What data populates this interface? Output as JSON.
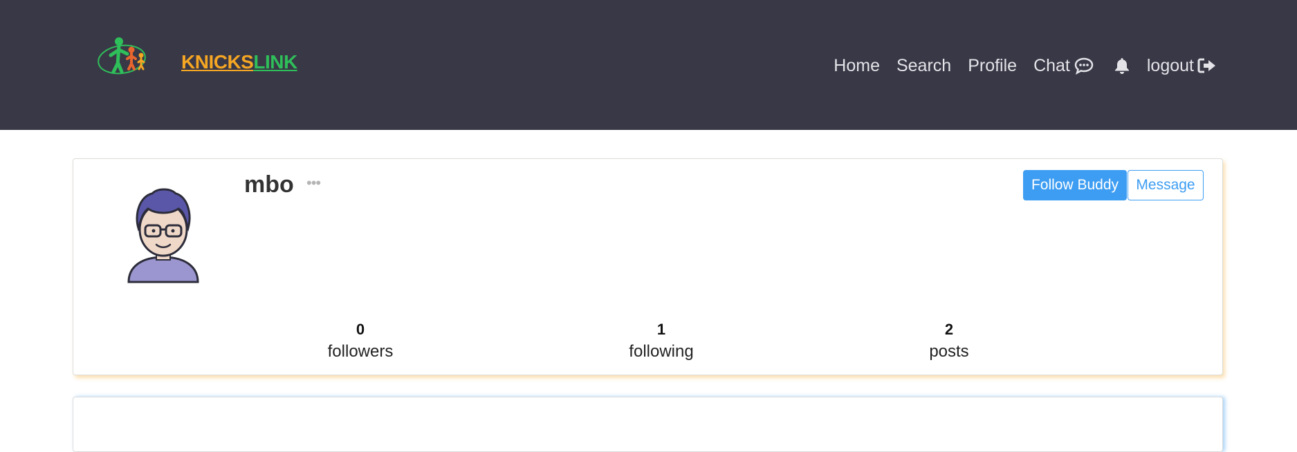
{
  "header": {
    "brand_part1": "KNICKS",
    "brand_part2": "LINK",
    "brand_colors": {
      "part1": "#f5a623",
      "part2": "#2fbf5a"
    },
    "background": "#393846",
    "nav": {
      "home": "Home",
      "search": "Search",
      "profile": "Profile",
      "chat": "Chat",
      "logout": "logout"
    },
    "icons": [
      "logo-icon",
      "chat-bubble-icon",
      "bell-icon",
      "sign-out-icon"
    ]
  },
  "profile": {
    "username": "mbo",
    "more": "•••",
    "follow_label": "Follow Buddy",
    "message_label": "Message",
    "stats": {
      "followers_count": "0",
      "followers_label": "followers",
      "following_count": "1",
      "following_label": "following",
      "posts_count": "2",
      "posts_label": "posts"
    },
    "accent": "#3d9df2"
  }
}
